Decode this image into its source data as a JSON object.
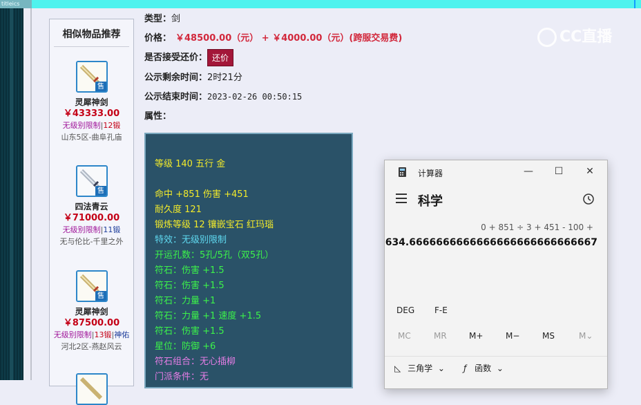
{
  "top_bar": {
    "tag": "titleics"
  },
  "sidebar": {
    "title": "相似物品推荐",
    "items": [
      {
        "name": "灵犀神剑",
        "price": "￥43333.00",
        "tag_a": "无级别限制",
        "tag_b": "12锻",
        "tag_c": "",
        "server": "山东5区-曲阜孔庙",
        "sold": "售",
        "icon": "sword-gold"
      },
      {
        "name": "四法青云",
        "price": "￥71000.00",
        "tag_a": "无级别限制",
        "tag_b": "11锻",
        "tag_c": "",
        "server": "无与伦比-千里之外",
        "sold": "售",
        "icon": "sword-silver"
      },
      {
        "name": "灵犀神剑",
        "price": "￥87500.00",
        "tag_a": "无级别限制",
        "tag_b": "13锻",
        "tag_c": "神佑",
        "server": "河北2区-燕赵风云",
        "sold": "售",
        "icon": "sword-gold"
      }
    ]
  },
  "detail": {
    "type_label": "类型：",
    "type_value": "剑",
    "price_label": "价格：",
    "price_value": "￥48500.00（元） + ￥4000.00（元）(跨服交易费)",
    "counter_label": "是否接受还价：",
    "counter_button": "还价",
    "remaining_label": "公示剩余时间：",
    "remaining_value": "2时21分",
    "end_label": "公示结束时间：",
    "end_value": "2023-02-26 00:50:15",
    "attr_label": "属性："
  },
  "attributes": [
    {
      "text": "等级 140 五行 金",
      "color": "yellow"
    },
    {
      "text": "命中 +851 伤害 +451",
      "color": "yellow"
    },
    {
      "text": "耐久度 121",
      "color": "yellow"
    },
    {
      "text": "锻炼等级 12 镶嵌宝石 红玛瑙",
      "color": "yellow"
    },
    {
      "text": "特效：无级别限制",
      "color": "cyan"
    },
    {
      "text": "开运孔数：5孔/5孔（双5孔）",
      "color": "green"
    },
    {
      "text": "符石：伤害 +1.5",
      "color": "green"
    },
    {
      "text": "符石：伤害 +1.5",
      "color": "green"
    },
    {
      "text": "符石：力量 +1",
      "color": "green"
    },
    {
      "text": "符石：力量 +1 速度 +1.5",
      "color": "green"
    },
    {
      "text": "符石：伤害 +1.5",
      "color": "green"
    },
    {
      "text": "星位：防御 +6",
      "color": "green"
    },
    {
      "text": "符石组合：无心插柳",
      "color": "magenta"
    },
    {
      "text": "门派条件：无",
      "color": "magenta"
    }
  ],
  "watermark": {
    "text": "CC直播"
  },
  "calculator": {
    "title": "计算器",
    "mode": "科学",
    "expression": "0 + 851 ÷ 3 + 451 - 100 +",
    "result": "634.6666666666666666666666666667",
    "row1": [
      "DEG",
      "F-E"
    ],
    "memory": [
      "MC",
      "MR",
      "M+",
      "M−",
      "MS",
      "M⌄"
    ],
    "trig_label": "三角学",
    "func_label": "函数",
    "minimize": "—",
    "maximize": "☐",
    "close": "✕"
  },
  "colors": {
    "price_red": "#c40016",
    "attr_bg": "#2a5268",
    "button_bg": "#a31739",
    "topbar": "#4ff3ee"
  }
}
